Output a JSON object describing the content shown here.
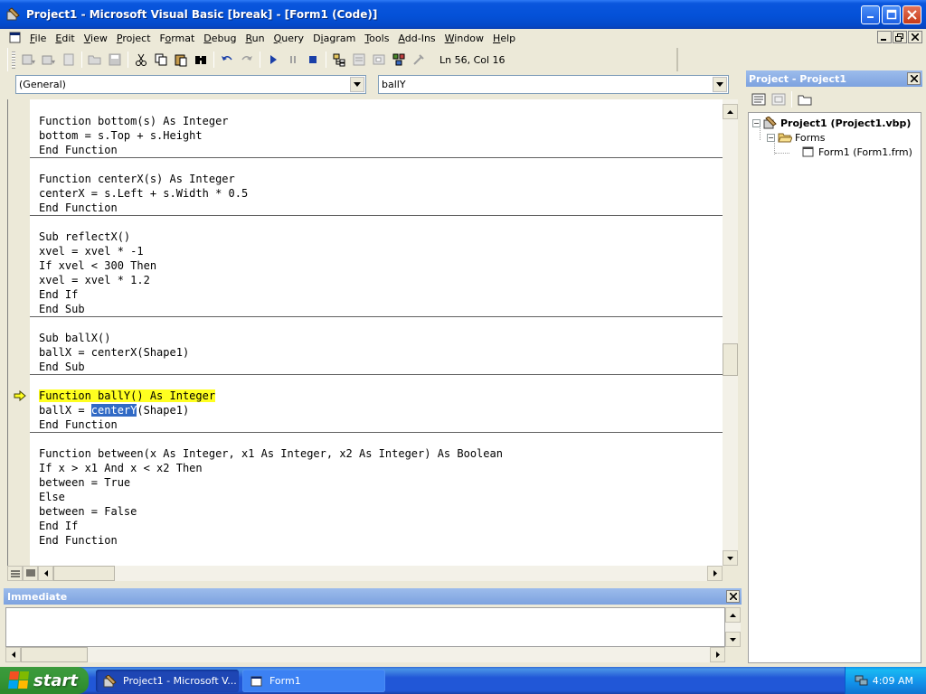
{
  "window": {
    "title": "Project1 - Microsoft Visual Basic [break] - [Form1 (Code)]",
    "minimize": "_",
    "maximize": "□",
    "close": "✕"
  },
  "menu": [
    {
      "pre": "",
      "key": "F",
      "post": "ile"
    },
    {
      "pre": "",
      "key": "E",
      "post": "dit"
    },
    {
      "pre": "",
      "key": "V",
      "post": "iew"
    },
    {
      "pre": "",
      "key": "P",
      "post": "roject"
    },
    {
      "pre": "F",
      "key": "o",
      "post": "rmat"
    },
    {
      "pre": "",
      "key": "D",
      "post": "ebug"
    },
    {
      "pre": "",
      "key": "R",
      "post": "un"
    },
    {
      "pre": "",
      "key": "Q",
      "post": "uery"
    },
    {
      "pre": "D",
      "key": "i",
      "post": "agram"
    },
    {
      "pre": "",
      "key": "T",
      "post": "ools"
    },
    {
      "pre": "",
      "key": "A",
      "post": "dd-Ins"
    },
    {
      "pre": "",
      "key": "W",
      "post": "indow"
    },
    {
      "pre": "",
      "key": "H",
      "post": "elp"
    }
  ],
  "toolbar": {
    "status": "Ln 56, Col 16"
  },
  "code_window": {
    "object_combo": "(General)",
    "procedure_combo": "ballY",
    "lines": [
      {
        "text": "Function bottom(s) As Integer"
      },
      {
        "text": "bottom = s.Top + s.Height"
      },
      {
        "text": "End Function"
      },
      {
        "text": ""
      },
      {
        "text": "Function centerX(s) As Integer"
      },
      {
        "text": "centerX = s.Left + s.Width * 0.5"
      },
      {
        "text": "End Function"
      },
      {
        "text": ""
      },
      {
        "text": "Sub reflectX()"
      },
      {
        "text": "xvel = xvel * -1"
      },
      {
        "text": "If xvel < 300 Then"
      },
      {
        "text": "xvel = xvel * 1.2"
      },
      {
        "text": "End If"
      },
      {
        "text": "End Sub"
      },
      {
        "text": ""
      },
      {
        "text": "Sub ballX()"
      },
      {
        "text": "ballX = centerX(Shape1)"
      },
      {
        "text": "End Sub"
      },
      {
        "text": ""
      },
      {
        "text": "Function ballY() As Integer",
        "highlight": true
      },
      {
        "text": "ballX = centerY(Shape1)",
        "selected": "centerY"
      },
      {
        "text": "End Function"
      },
      {
        "text": ""
      },
      {
        "text": "Function between(x As Integer, x1 As Integer, x2 As Integer) As Boolean"
      },
      {
        "text": "If x > x1 And x < x2 Then"
      },
      {
        "text": "between = True"
      },
      {
        "text": "Else"
      },
      {
        "text": "between = False"
      },
      {
        "text": "End If"
      },
      {
        "text": "End Function"
      }
    ]
  },
  "immediate": {
    "title": "Immediate"
  },
  "project_explorer": {
    "title": "Project - Project1",
    "tree": {
      "root": "Project1 (Project1.vbp)",
      "folder": "Forms",
      "form": "Form1 (Form1.frm)"
    }
  },
  "taskbar": {
    "start": "start",
    "tasks": [
      "Project1 - Microsoft V...",
      "Form1"
    ],
    "clock": "4:09 AM"
  },
  "colors": {
    "title_bar": "#0451d8",
    "pane_title": "#7da2df",
    "breakpoint_highlight": "#ffff20",
    "selection": "#316ac5",
    "taskbar": "#2157d7",
    "start_button": "#379737"
  }
}
